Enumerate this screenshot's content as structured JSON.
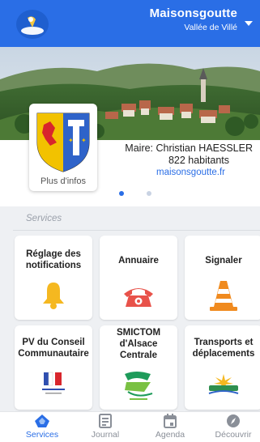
{
  "header": {
    "town_name": "Maisonsgoutte",
    "town_region": "Vallée de Villé"
  },
  "info": {
    "more_info_label": "Plus d'infos",
    "mayor": "Maire: Christian HAESSLER",
    "population": "822 habitants",
    "website": "maisonsgoutte.fr",
    "carousel_pages": 2,
    "carousel_active_index": 0
  },
  "services": {
    "title": "Services",
    "tiles": [
      {
        "label": "Réglage des notifications",
        "icon": "bell-icon"
      },
      {
        "label": "Annuaire",
        "icon": "telephone-icon"
      },
      {
        "label": "Signaler",
        "icon": "traffic-cone-icon"
      },
      {
        "label": "PV du Conseil Communautaire",
        "icon": "community-logo-icon"
      },
      {
        "label": "SMICTOM d'Alsace Centrale",
        "icon": "smictom-logo-icon"
      },
      {
        "label": "Transports et déplacements",
        "icon": "transport-logo-icon"
      }
    ]
  },
  "nav": {
    "items": [
      {
        "label": "Services",
        "icon": "services-icon",
        "active": true
      },
      {
        "label": "Journal",
        "icon": "journal-icon",
        "active": false
      },
      {
        "label": "Agenda",
        "icon": "calendar-icon",
        "active": false
      },
      {
        "label": "Découvrir",
        "icon": "discover-icon",
        "active": false
      }
    ]
  },
  "colors": {
    "primary": "#2a6ee6",
    "background": "#eef0f3",
    "bell": "#f5b820",
    "phone": "#e8524a",
    "cone": "#f08a1e"
  }
}
